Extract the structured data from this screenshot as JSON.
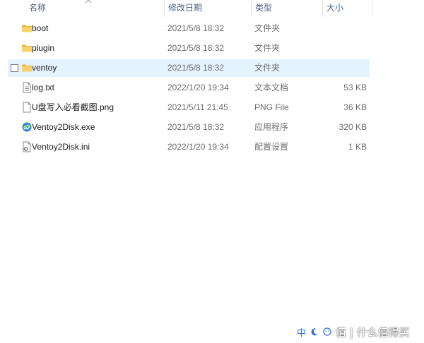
{
  "columns": {
    "name": "名称",
    "modified": "修改日期",
    "type": "类型",
    "size": "大小"
  },
  "files": [
    {
      "name": "boot",
      "modified": "2021/5/8 18:32",
      "type": "文件夹",
      "size": "",
      "icon": "folder-icon"
    },
    {
      "name": "plugin",
      "modified": "2021/5/8 18:32",
      "type": "文件夹",
      "size": "",
      "icon": "folder-icon"
    },
    {
      "name": "ventoy",
      "modified": "2021/5/8 18:32",
      "type": "文件夹",
      "size": "",
      "icon": "folder-icon"
    },
    {
      "name": "log.txt",
      "modified": "2022/1/20 19:34",
      "type": "文本文档",
      "size": "53 KB",
      "icon": "text-file-icon"
    },
    {
      "name": "U盘写入必看截图.png",
      "modified": "2021/5/11 21:45",
      "type": "PNG File",
      "size": "36 KB",
      "icon": "image-file-icon"
    },
    {
      "name": "Ventoy2Disk.exe",
      "modified": "2021/5/8 18:32",
      "type": "应用程序",
      "size": "320 KB",
      "icon": "app-icon"
    },
    {
      "name": "Ventoy2Disk.ini",
      "modified": "2022/1/20 19:34",
      "type": "配置设置",
      "size": "1 KB",
      "icon": "config-file-icon"
    }
  ],
  "selected_row": "ventoy",
  "watermark": {
    "ime_label": "中",
    "text": "值 | 什么值得买"
  }
}
